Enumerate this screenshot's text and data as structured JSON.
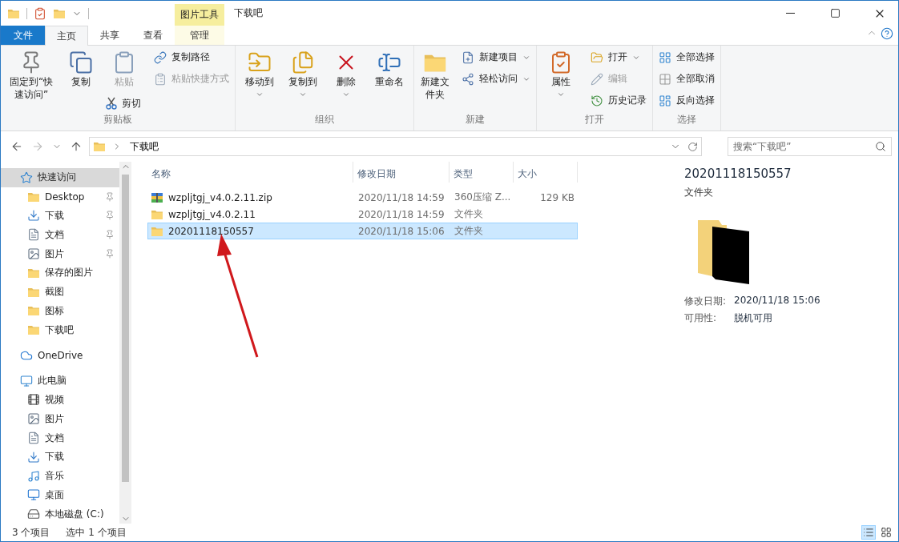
{
  "window": {
    "title": "下载吧",
    "context_label": "图片工具"
  },
  "ribbon_tabs": [
    {
      "label": "文件",
      "kind": "file",
      "selected": false
    },
    {
      "label": "主页",
      "kind": "normal",
      "selected": true
    },
    {
      "label": "共享",
      "kind": "normal",
      "selected": false
    },
    {
      "label": "查看",
      "kind": "normal",
      "selected": false
    },
    {
      "label": "管理",
      "kind": "context",
      "selected": false
    }
  ],
  "ribbon_groups": [
    {
      "label": "剪贴板",
      "columns": [
        [
          {
            "label": "固定到“快速访问”",
            "kind": "large",
            "disabled": false,
            "has_menu": false
          }
        ],
        [
          {
            "label": "复制",
            "kind": "large",
            "disabled": false,
            "has_menu": false
          }
        ],
        [
          {
            "label": "粘贴",
            "kind": "large",
            "disabled": true,
            "has_menu": false
          },
          {
            "label": "剪切",
            "kind": "small",
            "disabled": false,
            "has_menu": false
          }
        ],
        [
          {
            "label": "复制路径",
            "kind": "small",
            "disabled": false,
            "has_menu": false
          },
          {
            "label": "粘贴快捷方式",
            "kind": "small",
            "disabled": true,
            "has_menu": false
          }
        ]
      ]
    },
    {
      "label": "组织",
      "columns": [
        [
          {
            "label": "移动到",
            "kind": "large",
            "disabled": false,
            "has_menu": true
          }
        ],
        [
          {
            "label": "复制到",
            "kind": "large",
            "disabled": false,
            "has_menu": true
          }
        ],
        [
          {
            "label": "删除",
            "kind": "large",
            "disabled": false,
            "has_menu": true
          }
        ],
        [
          {
            "label": "重命名",
            "kind": "large",
            "disabled": false,
            "has_menu": false
          }
        ]
      ]
    },
    {
      "label": "新建",
      "columns": [
        [
          {
            "label": "新建文件夹",
            "kind": "large",
            "disabled": false,
            "has_menu": false
          }
        ],
        [
          {
            "label": "新建项目",
            "kind": "small",
            "disabled": false,
            "has_menu": true
          },
          {
            "label": "轻松访问",
            "kind": "small",
            "disabled": false,
            "has_menu": true
          }
        ]
      ]
    },
    {
      "label": "打开",
      "columns": [
        [
          {
            "label": "属性",
            "kind": "large",
            "disabled": false,
            "has_menu": true
          }
        ],
        [
          {
            "label": "打开",
            "kind": "small",
            "disabled": false,
            "has_menu": true
          },
          {
            "label": "编辑",
            "kind": "small",
            "disabled": true,
            "has_menu": false
          },
          {
            "label": "历史记录",
            "kind": "small",
            "disabled": false,
            "has_menu": false
          }
        ]
      ]
    },
    {
      "label": "选择",
      "columns": [
        [
          {
            "label": "全部选择",
            "kind": "small",
            "disabled": false,
            "has_menu": false
          },
          {
            "label": "全部取消",
            "kind": "small",
            "disabled": false,
            "has_menu": false
          },
          {
            "label": "反向选择",
            "kind": "small",
            "disabled": false,
            "has_menu": false
          }
        ]
      ]
    }
  ],
  "address_bar": {
    "path": [
      "下载吧"
    ]
  },
  "search": {
    "placeholder": "搜索“下载吧”"
  },
  "sidebar": {
    "items": [
      {
        "label": "快速访问",
        "selected": true,
        "children": [
          {
            "label": "Desktop",
            "pinned": true,
            "selected": false
          },
          {
            "label": "下载",
            "pinned": true,
            "selected": false
          },
          {
            "label": "文档",
            "pinned": true,
            "selected": false
          },
          {
            "label": "图片",
            "pinned": true,
            "selected": false
          },
          {
            "label": "保存的图片",
            "pinned": false,
            "selected": false
          },
          {
            "label": "截图",
            "pinned": false,
            "selected": false
          },
          {
            "label": "图标",
            "pinned": false,
            "selected": false
          },
          {
            "label": "下载吧",
            "pinned": false,
            "selected": false
          }
        ]
      },
      {
        "label": "OneDrive",
        "selected": false
      },
      {
        "label": "此电脑",
        "selected": false,
        "children": [
          {
            "label": "视频",
            "selected": false
          },
          {
            "label": "图片",
            "selected": false
          },
          {
            "label": "文档",
            "selected": false
          },
          {
            "label": "下载",
            "selected": false
          },
          {
            "label": "音乐",
            "selected": false
          },
          {
            "label": "桌面",
            "selected": false
          },
          {
            "label": "本地磁盘 (C:)",
            "selected": false
          }
        ]
      }
    ]
  },
  "file_list": {
    "columns": [
      "名称",
      "修改日期",
      "类型",
      "大小"
    ],
    "rows": [
      {
        "kind": "archive",
        "name": "wzpljtgj_v4.0.2.11.zip",
        "modified": "2020/11/18 14:59",
        "type": "360压缩 Z...",
        "size": "129 KB",
        "selected": false
      },
      {
        "kind": "folder",
        "name": "wzpljtgj_v4.0.2.11",
        "modified": "2020/11/18 14:59",
        "type": "文件夹",
        "selected": false
      },
      {
        "kind": "folder",
        "name": "20201118150557",
        "modified": "2020/11/18 15:06",
        "type": "文件夹",
        "selected": true
      }
    ]
  },
  "details_pane": {
    "name": "20201118150557",
    "type": "文件夹",
    "properties": [
      {
        "label": "修改日期:",
        "value": "2020/11/18 15:06"
      },
      {
        "label": "可用性:",
        "value": "脱机可用"
      }
    ]
  },
  "status_bar": {
    "items": [
      "3 个项目",
      "选中 1 个项目"
    ]
  }
}
